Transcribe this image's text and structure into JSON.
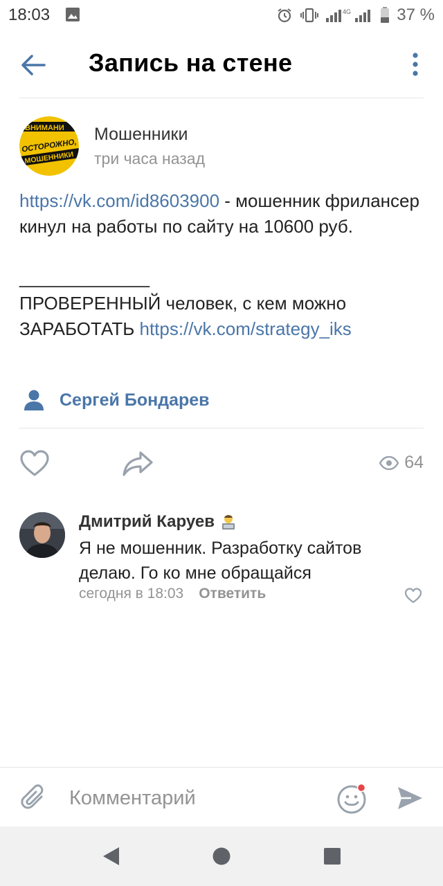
{
  "status_bar": {
    "time": "18:03",
    "battery": "37 %",
    "network": "4G"
  },
  "header": {
    "title": "Запись на стене"
  },
  "post": {
    "author": "Мошенники",
    "time": "три часа назад",
    "avatar_text": [
      "ВНИМАНИ",
      "ОСТОРОЖНО,",
      "МОШЕННИКИ"
    ],
    "line1_link": "https://vk.com/id8603900",
    "line1_rest": " - мошенник фрилансер кинул на работы по сайту на 10600 руб.",
    "separator": "_____________",
    "line2": "ПРОВЕРЕННЫЙ человек, с кем можно ЗАРАБОТАТЬ ",
    "line2_link": "https://vk.com/strategy_iks",
    "signer": "Сергей Бондарев",
    "views": "64"
  },
  "comment": {
    "author": "Дмитрий Каруев",
    "text": "Я не мошенник. Разработку сайтов делаю. Го ко мне  обращайся",
    "time": "сегодня в 18:03",
    "reply_label": "Ответить"
  },
  "input": {
    "placeholder": "Комментарий"
  },
  "colors": {
    "accent": "#4a76a8",
    "muted": "#939393",
    "divider": "#e4e6e9",
    "badge": "#e64646"
  }
}
